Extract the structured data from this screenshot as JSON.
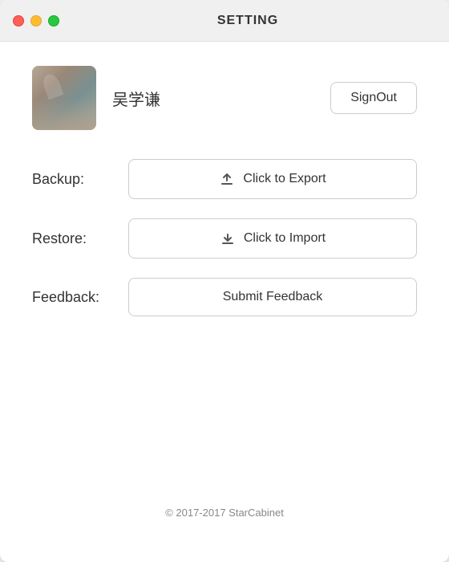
{
  "window": {
    "title": "SETTING"
  },
  "traffic": {
    "close": "close",
    "minimize": "minimize",
    "maximize": "maximize"
  },
  "profile": {
    "username": "吴学谦",
    "signout_label": "SignOut"
  },
  "backup": {
    "label": "Backup:",
    "button_label": "Click to Export"
  },
  "restore": {
    "label": "Restore:",
    "button_label": "Click to Import"
  },
  "feedback": {
    "label": "Feedback:",
    "button_label": "Submit Feedback"
  },
  "footer": {
    "text": "© 2017-2017 StarCabinet"
  }
}
